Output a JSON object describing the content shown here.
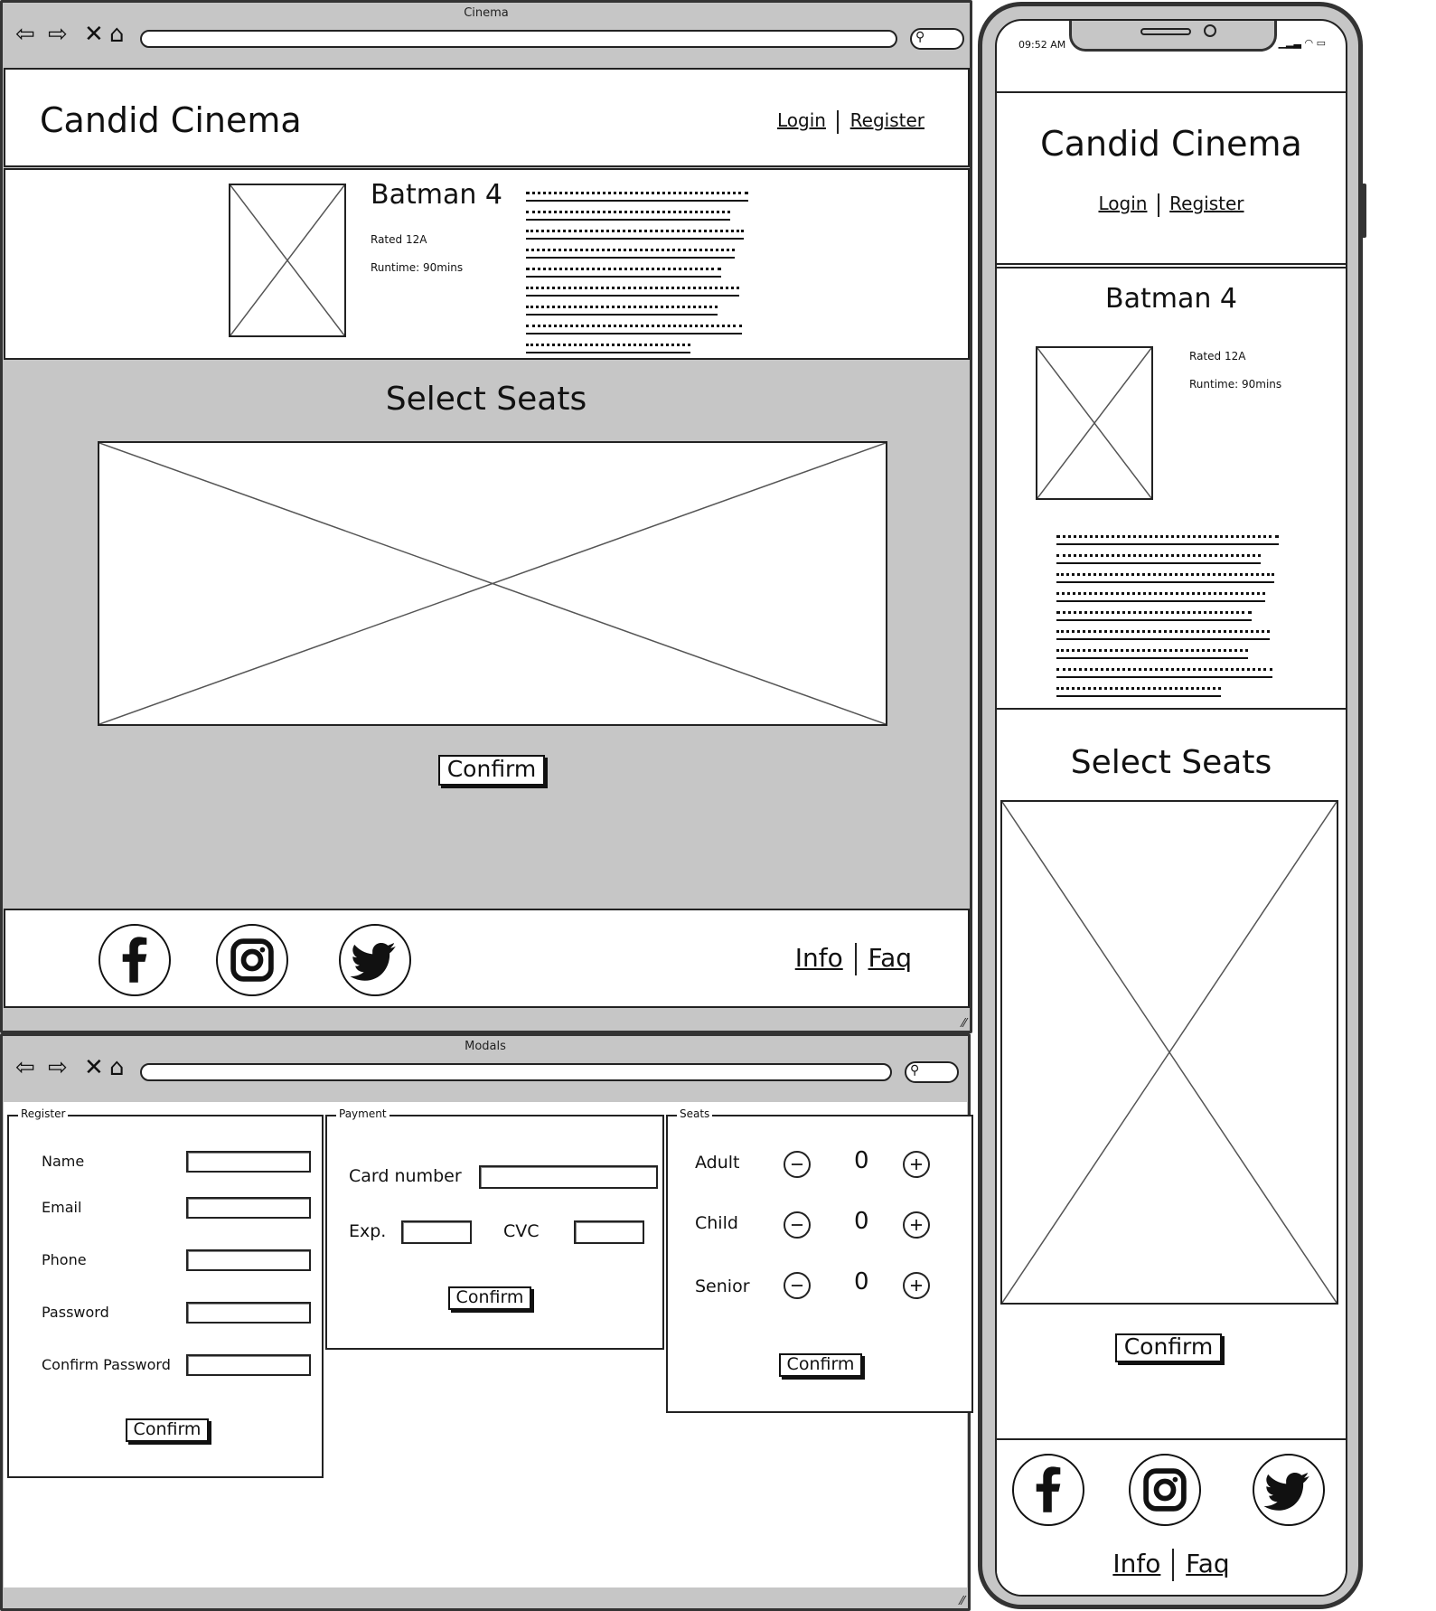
{
  "desktop_window": {
    "title": "Cinema",
    "header": {
      "brand": "Candid Cinema",
      "login": "Login",
      "register": "Register"
    },
    "movie": {
      "title": "Batman 4",
      "rating": "Rated 12A",
      "runtime": "Runtime: 90mins"
    },
    "seats": {
      "heading": "Select Seats",
      "confirm": "Confirm"
    },
    "footer": {
      "info": "Info",
      "faq": "Faq"
    }
  },
  "modals_window": {
    "title": "Modals",
    "register": {
      "legend": "Register",
      "fields": [
        "Name",
        "Email",
        "Phone",
        "Password",
        "Confirm Password"
      ],
      "confirm": "Confirm"
    },
    "payment": {
      "legend": "Payment",
      "card_number": "Card number",
      "exp": "Exp.",
      "cvc": "CVC",
      "confirm": "Confirm"
    },
    "seats": {
      "legend": "Seats",
      "rows": [
        {
          "label": "Adult",
          "count": "0"
        },
        {
          "label": "Child",
          "count": "0"
        },
        {
          "label": "Senior",
          "count": "0"
        }
      ],
      "confirm": "Confirm"
    }
  },
  "mobile": {
    "time": "09:52 AM",
    "header": {
      "brand": "Candid Cinema",
      "login": "Login",
      "register": "Register"
    },
    "movie": {
      "title": "Batman 4",
      "rating": "Rated 12A",
      "runtime": "Runtime: 90mins"
    },
    "seats": {
      "heading": "Select Seats",
      "confirm": "Confirm"
    },
    "footer": {
      "info": "Info",
      "faq": "Faq"
    }
  },
  "icons": [
    "back-arrow-icon",
    "forward-arrow-icon",
    "close-icon",
    "home-icon",
    "search-icon",
    "image-placeholder-icon",
    "facebook-icon",
    "instagram-icon",
    "twitter-icon",
    "minus-icon",
    "plus-icon",
    "signal-icon",
    "wifi-icon",
    "battery-icon",
    "resize-grip-icon"
  ]
}
